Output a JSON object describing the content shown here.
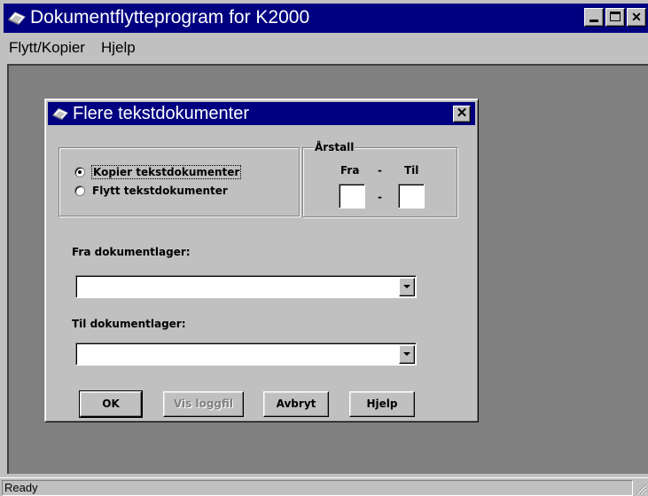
{
  "window": {
    "title": "Dokumentflytteprogram for K2000",
    "controls": {
      "minimize": "_",
      "maximize": "□",
      "close": "✕"
    }
  },
  "menu": {
    "items": [
      "Flytt/Kopier",
      "Hjelp"
    ]
  },
  "status_bar": {
    "text": "Ready"
  },
  "dialog": {
    "title": "Flere tekstdokumenter",
    "close_label": "✕",
    "mode_options": [
      {
        "label": "Kopier tekstdokumenter",
        "selected": true
      },
      {
        "label": "Flytt tekstdokumenter",
        "selected": false
      }
    ],
    "year_group": {
      "legend": "Årstall",
      "from_label": "Fra",
      "separator": "-",
      "to_label": "Til",
      "from_value": "",
      "to_value": ""
    },
    "from_store": {
      "label": "Fra dokumentlager:",
      "value": ""
    },
    "to_store": {
      "label": "Til dokumentlager:",
      "value": ""
    },
    "buttons": {
      "ok": "OK",
      "view_log": "Vis loggfil",
      "cancel": "Avbryt",
      "help": "Hjelp"
    },
    "view_log_enabled": false
  },
  "icons": {
    "app_icon": "application-icon",
    "dialog_icon": "application-icon"
  },
  "colors": {
    "titlebar": "#000080",
    "face": "#c0c0c0",
    "workspace": "#808080"
  }
}
